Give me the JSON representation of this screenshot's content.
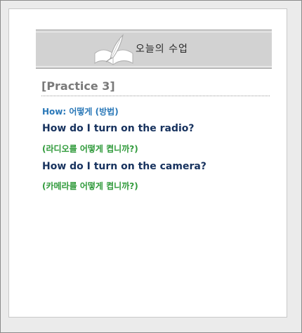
{
  "header": {
    "title": "오늘의 수업",
    "icon": "book-quill-icon"
  },
  "practice": {
    "title": "[Practice 3]",
    "how_line": "How: 어떻게 (방법)",
    "lines": [
      {
        "english": "How do I turn on the radio?",
        "korean": "(라디오를 어떻게 켭니까?)"
      },
      {
        "english": "How do I turn on the camera?",
        "korean": "(카메라를 어떻게 켭니까?)"
      }
    ]
  },
  "colors": {
    "how": "#2a78b8",
    "english": "#17325e",
    "korean": "#2f9a3a",
    "title": "#7a7a7a"
  }
}
